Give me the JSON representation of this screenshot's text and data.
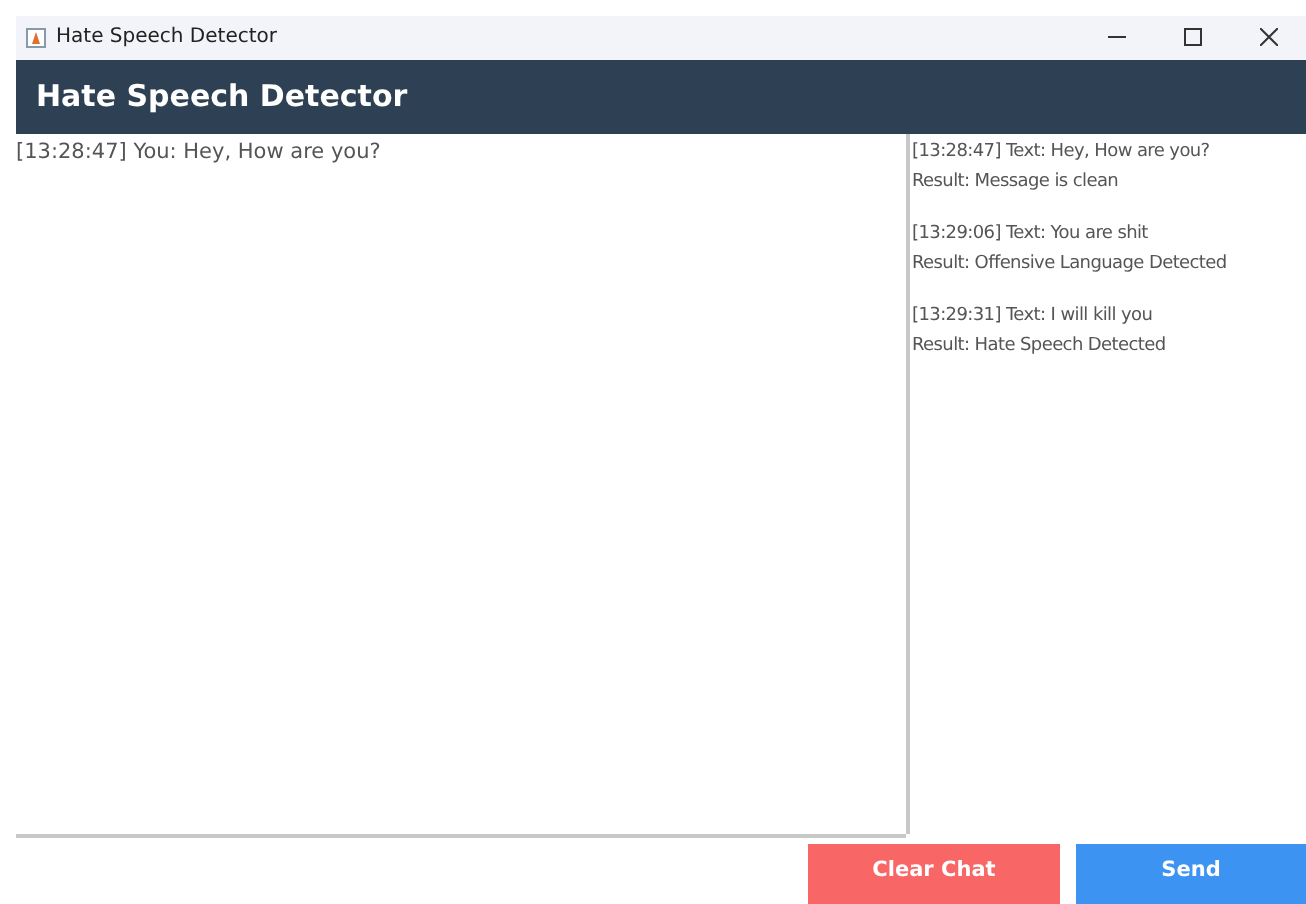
{
  "window": {
    "title": "Hate Speech Detector"
  },
  "header": {
    "title": "Hate Speech Detector"
  },
  "chat": {
    "messages": [
      "[13:28:47] You: Hey, How are you?"
    ]
  },
  "log": {
    "entries": [
      {
        "text": "[13:28:47] Text: Hey, How are you?",
        "result": "Result: Message is clean"
      },
      {
        "text": "[13:29:06] Text: You are shit",
        "result": "Result: Offensive Language Detected"
      },
      {
        "text": "[13:29:31] Text: I will kill you",
        "result": "Result: Hate Speech Detected"
      }
    ]
  },
  "buttons": [
    {
      "label": "Clear Chat",
      "kind": "danger"
    },
    {
      "label": "Send",
      "kind": "primary"
    }
  ]
}
